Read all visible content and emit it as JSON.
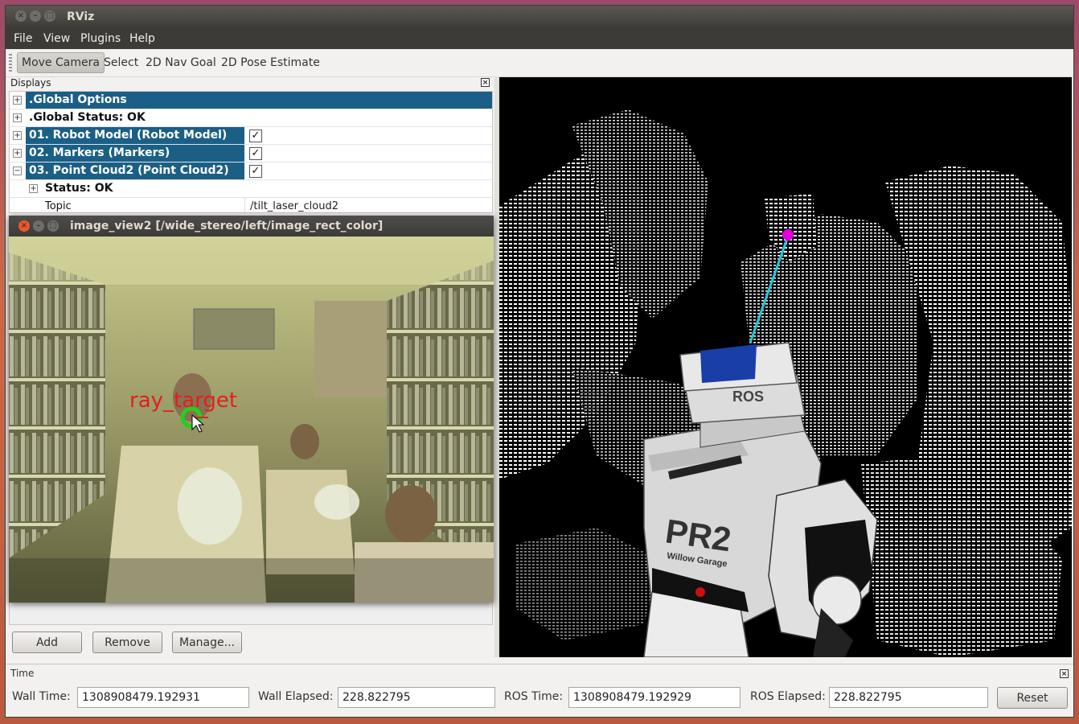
{
  "window": {
    "title": "RViz",
    "buttons": [
      "close-icon",
      "minimize-icon",
      "maximize-icon"
    ]
  },
  "menu": [
    "File",
    "View",
    "Plugins",
    "Help"
  ],
  "toolbar": {
    "tools": [
      "Move Camera",
      "Select",
      "2D Nav Goal",
      "2D Pose Estimate"
    ],
    "active": "Move Camera"
  },
  "displays": {
    "header": "Displays",
    "rows": [
      {
        "label": ".Global Options",
        "expander": "+",
        "selected": true,
        "checkbox": false
      },
      {
        "label": ".Global Status: OK",
        "expander": "+",
        "selected": false,
        "checkbox": false
      },
      {
        "label": "01. Robot Model (Robot Model)",
        "expander": "+",
        "selected": true,
        "checkbox": true
      },
      {
        "label": "02. Markers (Markers)",
        "expander": "+",
        "selected": true,
        "checkbox": true
      },
      {
        "label": "03. Point Cloud2 (Point Cloud2)",
        "expander": "−",
        "selected": true,
        "checkbox": true
      },
      {
        "label": "Status: OK",
        "expander": "+",
        "selected": false,
        "checkbox": false
      },
      {
        "label": "Topic",
        "value": "/tilt_laser_cloud2"
      }
    ],
    "buttons": {
      "add": "Add",
      "remove": "Remove",
      "manage": "Manage..."
    }
  },
  "image_view": {
    "title": "image_view2 [/wide_stereo/left/image_rect_color]",
    "overlay_label": "ray_target"
  },
  "robot": {
    "head_label": "ROS",
    "body_label": "PR2",
    "body_sublabel": "Willow Garage"
  },
  "time": {
    "header": "Time",
    "wall_time_label": "Wall Time:",
    "wall_time": "1308908479.192931",
    "wall_elapsed_label": "Wall Elapsed:",
    "wall_elapsed": "228.822795",
    "ros_time_label": "ROS Time:",
    "ros_time": "1308908479.192929",
    "ros_elapsed_label": "ROS Elapsed:",
    "ros_elapsed": "228.822795",
    "reset_label": "Reset"
  },
  "colors": {
    "selection": "#1b5f86",
    "marker_line": "#20c8d8",
    "marker_point": "#e000e0",
    "overlay_text": "#e02020",
    "overlay_circle": "#20d020"
  }
}
